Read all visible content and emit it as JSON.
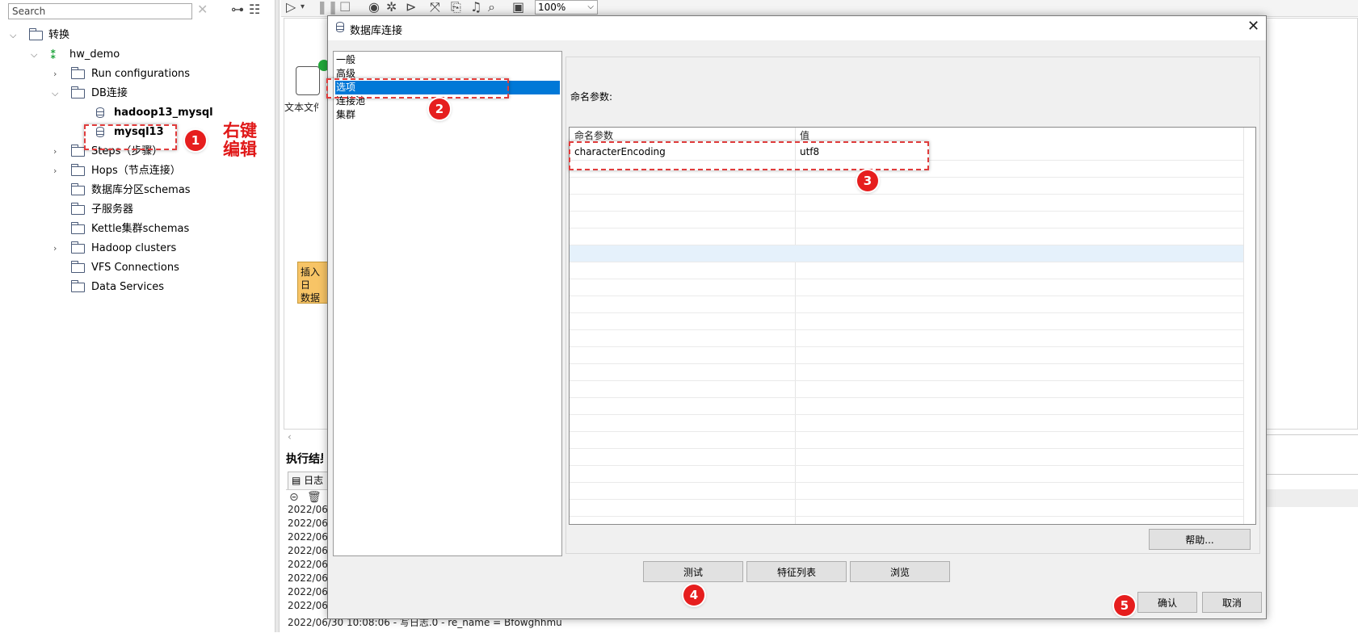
{
  "left_panel": {
    "search_placeholder": "Search",
    "tree": {
      "root": "转换",
      "project": "hw_demo",
      "items": [
        {
          "label": "Run configurations"
        },
        {
          "label": "DB连接"
        },
        {
          "label": "hadoop13_mysql"
        },
        {
          "label": "mysql13"
        },
        {
          "label": "Steps（步骤）"
        },
        {
          "label": "Hops（节点连接）"
        },
        {
          "label": "数据库分区schemas"
        },
        {
          "label": "子服务器"
        },
        {
          "label": "Kettle集群schemas"
        },
        {
          "label": "Hadoop clusters"
        },
        {
          "label": "VFS Connections"
        },
        {
          "label": "Data Services"
        }
      ]
    }
  },
  "editor": {
    "zoom": "100%",
    "step_label": "文本文件输",
    "note_lines": [
      "插入日",
      "数据处"
    ],
    "exec_title": "执行结果",
    "log_tab": "日志",
    "log_lines": [
      "2022/06/",
      "2022/06/",
      "2022/06/",
      "2022/06/",
      "2022/06/",
      "2022/06/",
      "2022/06/",
      "2022/06/",
      "2022/06/30 10:08:06 - 写日志.0 - re_name = Bfowghhmu"
    ]
  },
  "dialog": {
    "title": "数据库连接",
    "close_icon": "✕",
    "nav_items": [
      "一般",
      "高级",
      "选项",
      "连接池",
      "集群"
    ],
    "selected_nav": "选项",
    "section_label": "命名参数:",
    "table": {
      "columns": [
        "命名参数",
        "值"
      ],
      "rows": [
        {
          "name": "characterEncoding",
          "value": "utf8"
        }
      ]
    },
    "buttons": {
      "help": "帮助...",
      "test": "测试",
      "features": "特征列表",
      "explore": "浏览",
      "ok": "确认",
      "cancel": "取消"
    }
  },
  "annotations": {
    "handwrite": [
      "右键",
      "编辑"
    ],
    "steps": [
      "1",
      "2",
      "3",
      "4",
      "5"
    ],
    "color": "#e61e1e"
  }
}
